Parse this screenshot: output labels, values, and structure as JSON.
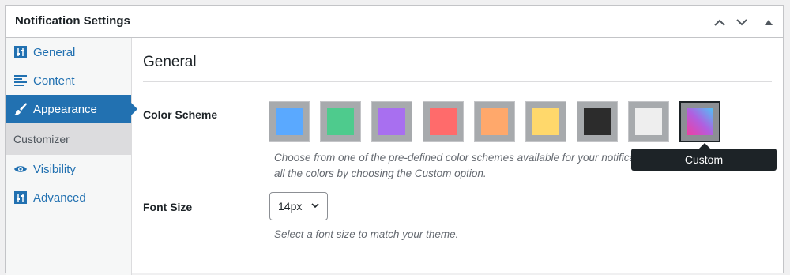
{
  "panel": {
    "title": "Notification Settings",
    "controls": [
      "chevron-up",
      "chevron-down",
      "toggle-triangle"
    ]
  },
  "sidebar": {
    "items": [
      {
        "label": "General",
        "icon": "sliders-icon"
      },
      {
        "label": "Content",
        "icon": "align-left-icon"
      },
      {
        "label": "Appearance",
        "icon": "paintbrush-icon",
        "active": true
      },
      {
        "label": "Customizer",
        "sub": true
      },
      {
        "label": "Visibility",
        "icon": "eye-icon"
      },
      {
        "label": "Advanced",
        "icon": "sliders-icon"
      }
    ]
  },
  "main": {
    "section_title": "General",
    "color_scheme": {
      "label": "Color Scheme",
      "swatches": [
        {
          "color": "#5aa9ff"
        },
        {
          "color": "#4ecb8d"
        },
        {
          "color": "#a86ff0"
        },
        {
          "color": "#ff6b6b"
        },
        {
          "color": "#ffa86b"
        },
        {
          "color": "#ffd86b"
        },
        {
          "color": "#2c2c2c"
        },
        {
          "color": "#eeeeee"
        },
        {
          "color": "gradient",
          "selected": true
        }
      ],
      "description_line1": "Choose from one of the pre-defined color schemes available for your notification or customize",
      "description_line2": "all the colors by choosing the Custom option.",
      "tooltip": "Custom"
    },
    "font_size": {
      "label": "Font Size",
      "value": "14px",
      "description": "Select a font size to match your theme."
    }
  }
}
